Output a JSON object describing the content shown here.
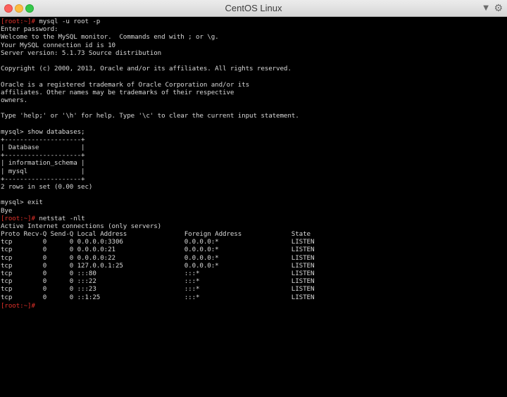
{
  "window": {
    "title": "CentOS Linux",
    "icons": {
      "dropdown": "chevron-down-icon",
      "settings": "gear-icon"
    }
  },
  "terminal": {
    "prompt": "[root:~]#",
    "lines": [
      {
        "p": true,
        "t": " mysql -u root -p"
      },
      {
        "p": false,
        "t": "Enter password:"
      },
      {
        "p": false,
        "t": "Welcome to the MySQL monitor.  Commands end with ; or \\g."
      },
      {
        "p": false,
        "t": "Your MySQL connection id is 10"
      },
      {
        "p": false,
        "t": "Server version: 5.1.73 Source distribution"
      },
      {
        "p": false,
        "t": ""
      },
      {
        "p": false,
        "t": "Copyright (c) 2000, 2013, Oracle and/or its affiliates. All rights reserved."
      },
      {
        "p": false,
        "t": ""
      },
      {
        "p": false,
        "t": "Oracle is a registered trademark of Oracle Corporation and/or its"
      },
      {
        "p": false,
        "t": "affiliates. Other names may be trademarks of their respective"
      },
      {
        "p": false,
        "t": "owners."
      },
      {
        "p": false,
        "t": ""
      },
      {
        "p": false,
        "t": "Type 'help;' or '\\h' for help. Type '\\c' to clear the current input statement."
      },
      {
        "p": false,
        "t": ""
      },
      {
        "p": false,
        "t": "mysql> show databases;"
      },
      {
        "p": false,
        "t": "+--------------------+"
      },
      {
        "p": false,
        "t": "| Database           |"
      },
      {
        "p": false,
        "t": "+--------------------+"
      },
      {
        "p": false,
        "t": "| information_schema |"
      },
      {
        "p": false,
        "t": "| mysql              |"
      },
      {
        "p": false,
        "t": "+--------------------+"
      },
      {
        "p": false,
        "t": "2 rows in set (0.00 sec)"
      },
      {
        "p": false,
        "t": ""
      },
      {
        "p": false,
        "t": "mysql> exit"
      },
      {
        "p": false,
        "t": "Bye"
      },
      {
        "p": true,
        "t": " netstat -nlt"
      },
      {
        "p": false,
        "t": "Active Internet connections (only servers)"
      },
      {
        "p": false,
        "t": "Proto Recv-Q Send-Q Local Address               Foreign Address             State"
      },
      {
        "p": false,
        "t": "tcp        0      0 0.0.0.0:3306                0.0.0.0:*                   LISTEN"
      },
      {
        "p": false,
        "t": "tcp        0      0 0.0.0.0:21                  0.0.0.0:*                   LISTEN"
      },
      {
        "p": false,
        "t": "tcp        0      0 0.0.0.0:22                  0.0.0.0:*                   LISTEN"
      },
      {
        "p": false,
        "t": "tcp        0      0 127.0.0.1:25                0.0.0.0:*                   LISTEN"
      },
      {
        "p": false,
        "t": "tcp        0      0 :::80                       :::*                        LISTEN"
      },
      {
        "p": false,
        "t": "tcp        0      0 :::22                       :::*                        LISTEN"
      },
      {
        "p": false,
        "t": "tcp        0      0 :::23                       :::*                        LISTEN"
      },
      {
        "p": false,
        "t": "tcp        0      0 ::1:25                      :::*                        LISTEN"
      },
      {
        "p": true,
        "t": ""
      }
    ]
  }
}
